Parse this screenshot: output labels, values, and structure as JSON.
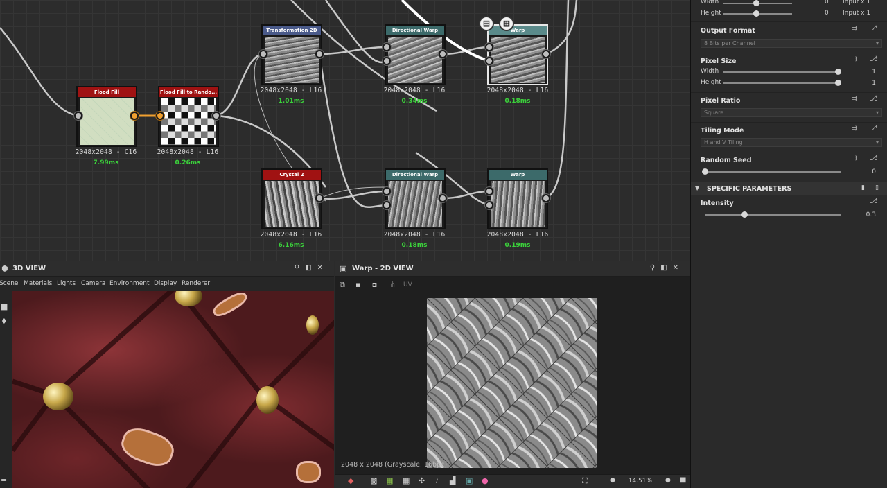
{
  "graph": {
    "nodes": [
      {
        "title": "Flood Fill",
        "header": "#a01212",
        "res": "2048x2048 - C16",
        "time": "7.99ms"
      },
      {
        "title": "Flood Fill to Rando...",
        "header": "#a01212",
        "res": "2048x2048 - L16",
        "time": "0.26ms"
      },
      {
        "title": "Transformation 2D",
        "header": "#4a5a8a",
        "res": "2048x2048 - L16",
        "time": "1.01ms"
      },
      {
        "title": "Directional Warp",
        "header": "#3c6a6a",
        "res": "2048x2048 - L16",
        "time": "0.34ms"
      },
      {
        "title": "Warp",
        "header": "#5a8a8a",
        "res": "2048x2048 - L16",
        "time": "0.18ms"
      },
      {
        "title": "Crystal 2",
        "header": "#a01212",
        "res": "2048x2048 - L16",
        "time": "6.16ms"
      },
      {
        "title": "Directional Warp",
        "header": "#3c6a6a",
        "res": "2048x2048 - L16",
        "time": "0.18ms"
      },
      {
        "title": "Warp",
        "header": "#3c6a6a",
        "res": "2048x2048 - L16",
        "time": "0.19ms"
      }
    ]
  },
  "panel": {
    "top_width_label": "Width",
    "top_width_val": "0",
    "top_width_mode": "Input x 1",
    "top_height_label": "Height",
    "top_height_val": "0",
    "top_height_mode": "Input x 1",
    "output_format_label": "Output Format",
    "output_format_value": "8 Bits per Channel",
    "pixel_size_label": "Pixel Size",
    "ps_width_label": "Width",
    "ps_width_val": "1",
    "ps_height_label": "Height",
    "ps_height_val": "1",
    "pixel_ratio_label": "Pixel Ratio",
    "pixel_ratio_value": "Square",
    "tiling_label": "Tiling Mode",
    "tiling_value": "H and V Tiling",
    "seed_label": "Random Seed",
    "seed_val": "0",
    "specific_title": "SPECIFIC PARAMETERS",
    "intensity_label": "Intensity",
    "intensity_val": "0.3"
  },
  "view3d": {
    "title": "3D VIEW",
    "menu": [
      "Scene",
      "Materials",
      "Lights",
      "Camera",
      "Environment",
      "Display",
      "Renderer"
    ]
  },
  "view2d": {
    "title": "Warp - 2D VIEW",
    "uv": "UV",
    "info": "2048 x 2048 (Grayscale, 16bpc)",
    "zoom": "14.51%"
  }
}
